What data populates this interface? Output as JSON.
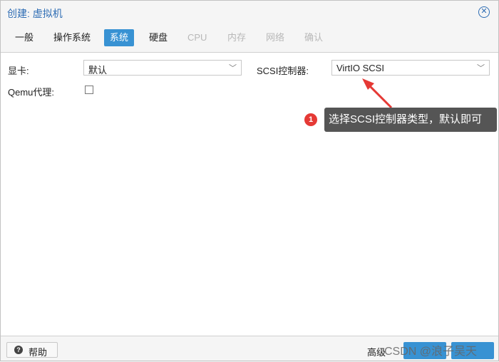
{
  "window": {
    "title": "创建: 虚拟机"
  },
  "tabs": [
    {
      "label": "一般"
    },
    {
      "label": "操作系统"
    },
    {
      "label": "系统"
    },
    {
      "label": "硬盘"
    },
    {
      "label": "CPU"
    },
    {
      "label": "内存"
    },
    {
      "label": "网络"
    },
    {
      "label": "确认"
    }
  ],
  "form": {
    "graphics_label": "显卡:",
    "graphics_value": "默认",
    "scsi_label": "SCSI控制器:",
    "scsi_value": "VirtIO SCSI",
    "qemu_label": "Qemu代理:",
    "qemu_checked": false
  },
  "annotation": {
    "badge": "1",
    "text": "选择SCSI控制器类型，默认即可"
  },
  "footer": {
    "help_label": "帮助",
    "advanced_label": "高级",
    "watermark": "CSDN @浪子吴天"
  },
  "colors": {
    "accent": "#3892d3",
    "title": "#2e6db4",
    "arrow": "#e53935"
  }
}
